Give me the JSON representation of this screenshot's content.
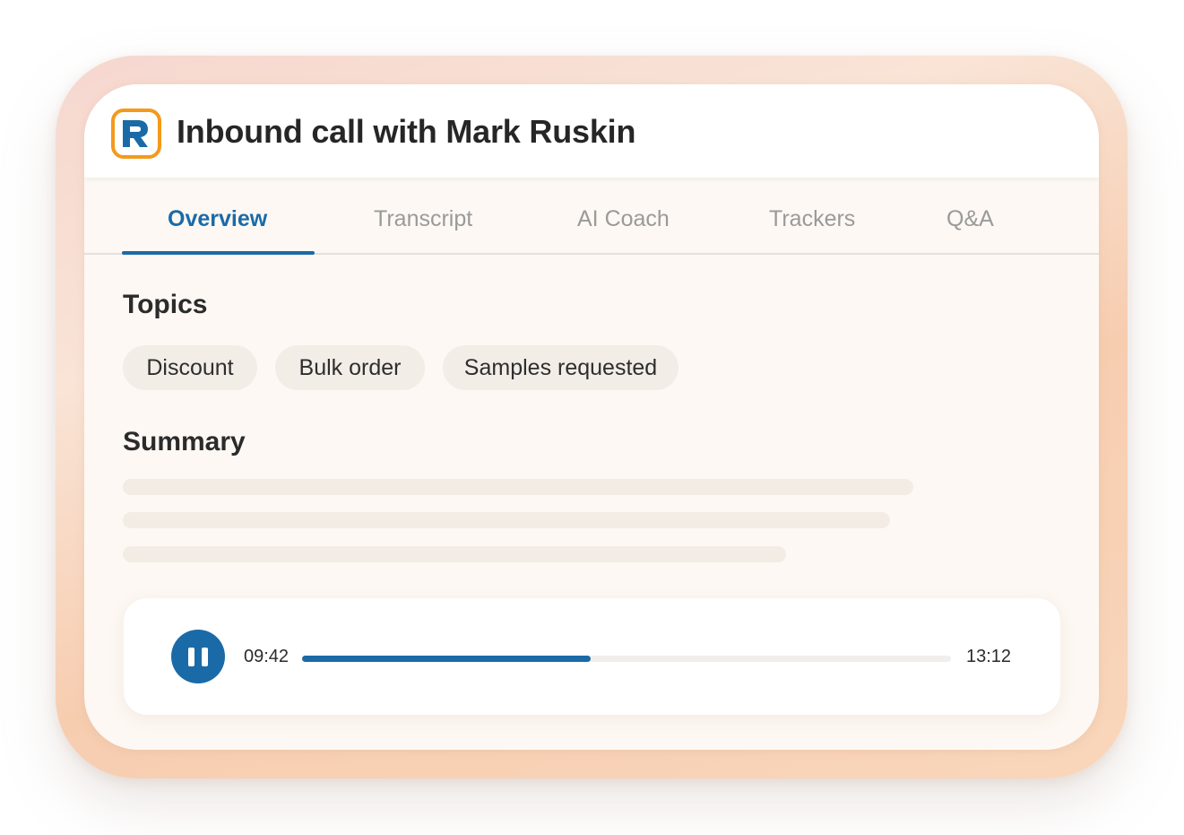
{
  "header": {
    "title": "Inbound call with Mark Ruskin",
    "logo_letter": "R",
    "logo_color": "#f39a1b",
    "logo_letter_color": "#1b6aa8"
  },
  "tabs": [
    {
      "label": "Overview",
      "active": true
    },
    {
      "label": "Transcript",
      "active": false
    },
    {
      "label": "AI Coach",
      "active": false
    },
    {
      "label": "Trackers",
      "active": false
    },
    {
      "label": "Q&A",
      "active": false
    }
  ],
  "topics": {
    "title": "Topics",
    "chips": [
      "Discount",
      "Bulk order",
      "Samples requested"
    ]
  },
  "summary": {
    "title": "Summary"
  },
  "player": {
    "current_time": "09:42",
    "total_time": "13:12",
    "progress_fraction": 0.445,
    "state": "playing",
    "icon": "pause-icon"
  },
  "colors": {
    "accent": "#1b6aa8",
    "chip_bg": "#f3ede7",
    "card_bg": "#fdf8f3"
  }
}
